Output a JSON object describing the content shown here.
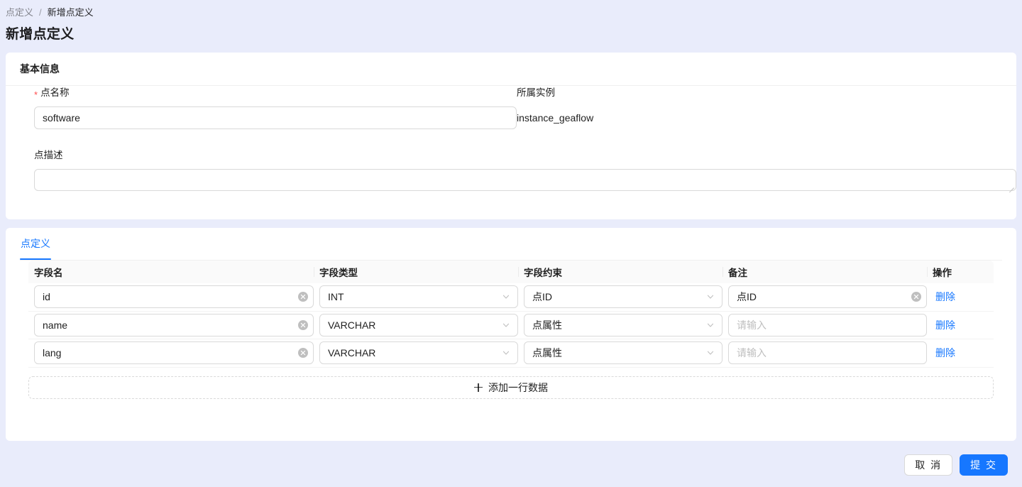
{
  "breadcrumb": {
    "parent": "点定义",
    "separator": "/",
    "current": "新增点定义"
  },
  "page_title": "新增点定义",
  "basic_card": {
    "header": "基本信息",
    "name_field": {
      "required_mark": "*",
      "label": "点名称",
      "value": "software"
    },
    "instance_field": {
      "label": "所属实例",
      "value": "instance_geaflow"
    },
    "desc_field": {
      "label": "点描述",
      "value": ""
    }
  },
  "definition_card": {
    "tabs": [
      {
        "label": "点定义",
        "active": true
      }
    ],
    "table": {
      "headers": {
        "field_name": "字段名",
        "field_type": "字段类型",
        "field_constraint": "字段约束",
        "remark": "备注",
        "action": "操作"
      },
      "rows": [
        {
          "field_name": "id",
          "field_type": "INT",
          "field_constraint": "点ID",
          "remark": "点ID",
          "remark_placeholder": "请输入",
          "action": "删除"
        },
        {
          "field_name": "name",
          "field_type": "VARCHAR",
          "field_constraint": "点属性",
          "remark": "",
          "remark_placeholder": "请输入",
          "action": "删除"
        },
        {
          "field_name": "lang",
          "field_type": "VARCHAR",
          "field_constraint": "点属性",
          "remark": "",
          "remark_placeholder": "请输入",
          "action": "删除"
        }
      ],
      "add_row_label": "添加一行数据"
    }
  },
  "footer": {
    "cancel_label": "取 消",
    "submit_label": "提 交"
  },
  "colors": {
    "primary": "#1677ff",
    "page_background": "#e9ecfb",
    "card_background": "#ffffff",
    "required_star": "#ff4d4f",
    "table_header_background": "#fafafa"
  }
}
